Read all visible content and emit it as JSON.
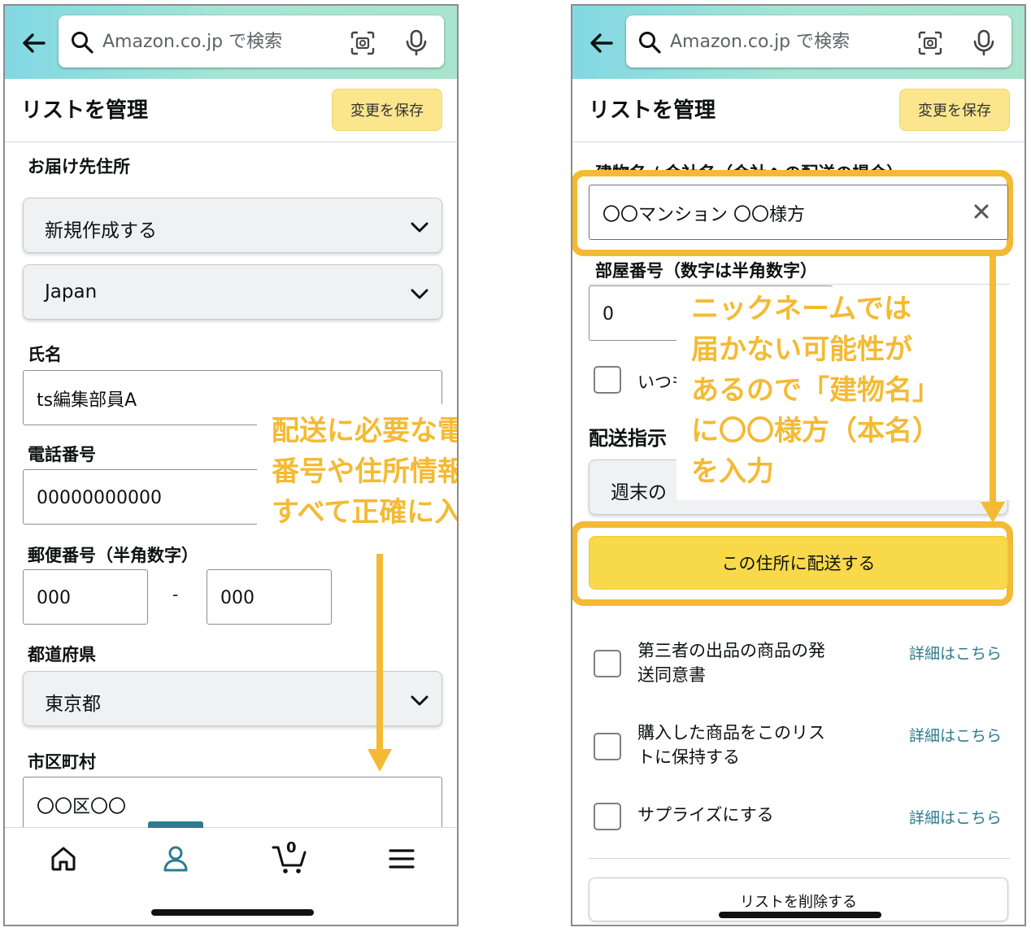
{
  "search": {
    "placeholder": "Amazon.co.jp で検索"
  },
  "header": {
    "title": "リストを管理",
    "save_label": "変更を保存"
  },
  "left": {
    "delivery_label": "お届け先住所",
    "address_select": "新規作成する",
    "country_select": "Japan",
    "name_label": "氏名",
    "name_value": "ts編集部員A",
    "phone_label": "電話番号",
    "phone_value": "00000000000",
    "postal_label": "郵便番号（半角数字）",
    "postal_1": "000",
    "postal_sep": "-",
    "postal_2": "000",
    "pref_label": "都道府県",
    "pref_select": "東京都",
    "city_label": "市区町村",
    "city_value": "〇〇区〇〇",
    "callout_lines": [
      "配送に必要な電話",
      "番号や住所情報は",
      "すべて正確に入力"
    ]
  },
  "right": {
    "building_label": "建物名 / 会社名（会社への配送の場合）",
    "building_value": "〇〇マンション 〇〇様方",
    "room_label": "部屋番号（数字は半角数字）",
    "room_value": "0",
    "default_check_label": "いつも",
    "instructions_label": "配送指示",
    "instructions_select": "週末の",
    "ship_button": "この住所に配送する",
    "callout_lines": [
      "ニックネームでは",
      "届かない可能性が",
      "あるので「建物名」",
      "に〇〇様方（本名）",
      "を入力"
    ],
    "options": [
      {
        "text_line1": "第三者の出品の商品の発",
        "text_line2": "送同意書",
        "link": "詳細はこちら"
      },
      {
        "text_line1": "購入した商品をこのリス",
        "text_line2": "トに保持する",
        "link": "詳細はこちら"
      },
      {
        "text_line1": "サプライズにする",
        "text_line2": "",
        "link": "詳細はこちら"
      }
    ],
    "delete_button": "リストを削除する"
  },
  "nav": {
    "cart_count": "0"
  },
  "colors": {
    "accent": "#f4ba33",
    "teal": "#2d7b8e",
    "save_button": "#fbe68d",
    "ship_button": "#f8d94a"
  }
}
